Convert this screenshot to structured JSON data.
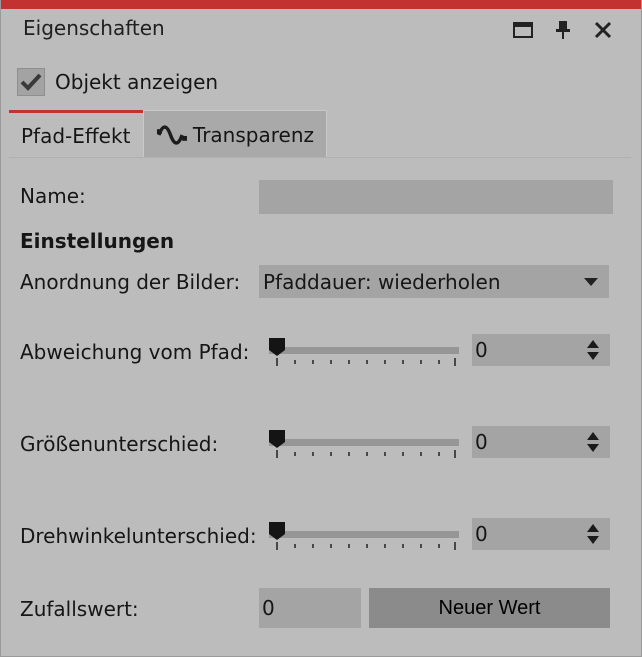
{
  "window": {
    "title": "Eigenschaften",
    "buttons": [
      "maximize-icon",
      "pin-icon",
      "close-icon"
    ]
  },
  "show_object": {
    "label": "Objekt anzeigen",
    "checked": true
  },
  "tabs": [
    {
      "label": "Pfad-Effekt",
      "active": true
    },
    {
      "label": "Transparenz",
      "active": false,
      "icon": "wave-icon"
    }
  ],
  "form": {
    "name_label": "Name:",
    "name_value": "",
    "settings_heading": "Einstellungen",
    "arrangement_label": "Anordnung der Bilder:",
    "arrangement_value": "Pfaddauer: wiederholen",
    "deviation": {
      "label": "Abweichung vom Pfad:",
      "value": "0",
      "slider_fraction": 0
    },
    "size_diff": {
      "label": "Größenunterschied:",
      "value": "0",
      "slider_fraction": 0
    },
    "rotation_diff": {
      "label": "Drehwinkelunterschied:",
      "value": "0",
      "slider_fraction": 0
    },
    "random_label": "Zufallswert:",
    "random_value": "0",
    "new_value_button": "Neuer Wert"
  },
  "colors": {
    "accent": "#c23230",
    "panel": "#bcbcbc",
    "field": "#a4a4a4",
    "button": "#8b8b8b"
  }
}
